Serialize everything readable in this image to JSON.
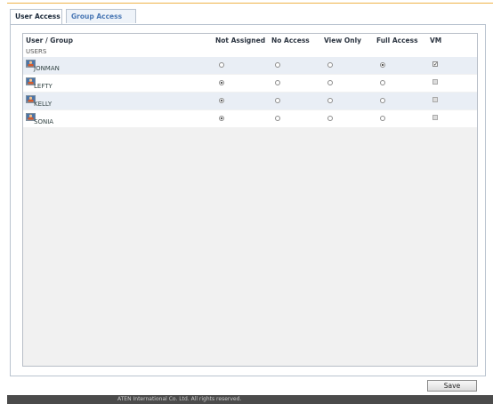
{
  "tabs": [
    {
      "label": "User Access",
      "active": true
    },
    {
      "label": "Group Access",
      "active": false
    }
  ],
  "table": {
    "columns": [
      "User / Group",
      "Not Assigned",
      "No Access",
      "View Only",
      "Full Access",
      "VM"
    ],
    "group_label": "USERS",
    "rows": [
      {
        "name": "JONMAN",
        "selected": "Full Access",
        "vm": true,
        "vm_enabled": true
      },
      {
        "name": "LEFTY",
        "selected": "Not Assigned",
        "vm": false,
        "vm_enabled": false
      },
      {
        "name": "KELLY",
        "selected": "Not Assigned",
        "vm": false,
        "vm_enabled": false
      },
      {
        "name": "SONIA",
        "selected": "Not Assigned",
        "vm": false,
        "vm_enabled": false
      }
    ]
  },
  "buttons": {
    "save_label": "Save"
  },
  "footer": {
    "text": "ATEN International Co. Ltd. All rights reserved."
  },
  "colors": {
    "accent": "#f0b44a",
    "tab_link": "#4a78b5",
    "row_alt": "#e9eef5",
    "footer_bg": "#4b4b4b"
  },
  "icons": {
    "user": "user-icon"
  }
}
